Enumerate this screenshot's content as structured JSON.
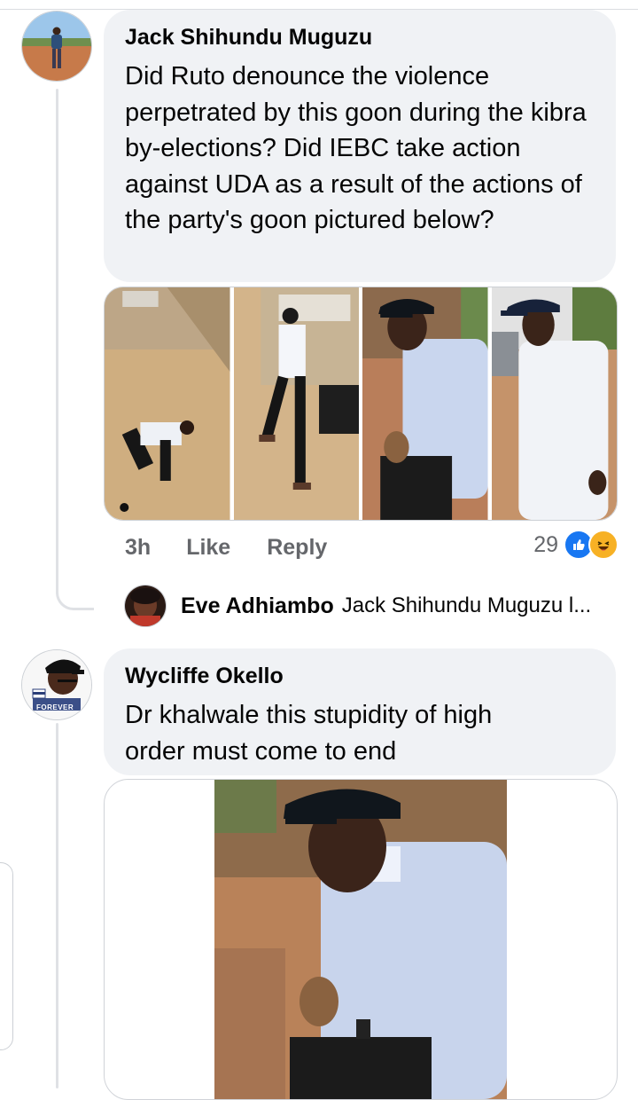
{
  "comments": [
    {
      "author": "Jack Shihundu Muguzu",
      "text": "Did Ruto denounce the violence perpetrated by this goon during the kibra by-elections? Did IEBC take action against UDA as a result of the actions of the party's goon pictured below?",
      "time": "3h",
      "like_label": "Like",
      "reply_label": "Reply",
      "reaction_count": "29",
      "reactions": [
        "like-icon",
        "haha-icon"
      ],
      "photo_count": 4
    },
    {
      "author": "Wycliffe Okello",
      "text": "Dr khalwale this stupidity of high order must come to end",
      "avatar_caption": "FOREVER"
    }
  ],
  "reply": {
    "author": "Eve Adhiambo",
    "preview": "Jack Shihundu Muguzu l..."
  },
  "colors": {
    "bubble": "#f0f2f5",
    "meta_text": "#65676b",
    "like_blue": "#1877f2",
    "haha_yellow": "#f7b125",
    "thread_line": "#dfe1e5"
  }
}
